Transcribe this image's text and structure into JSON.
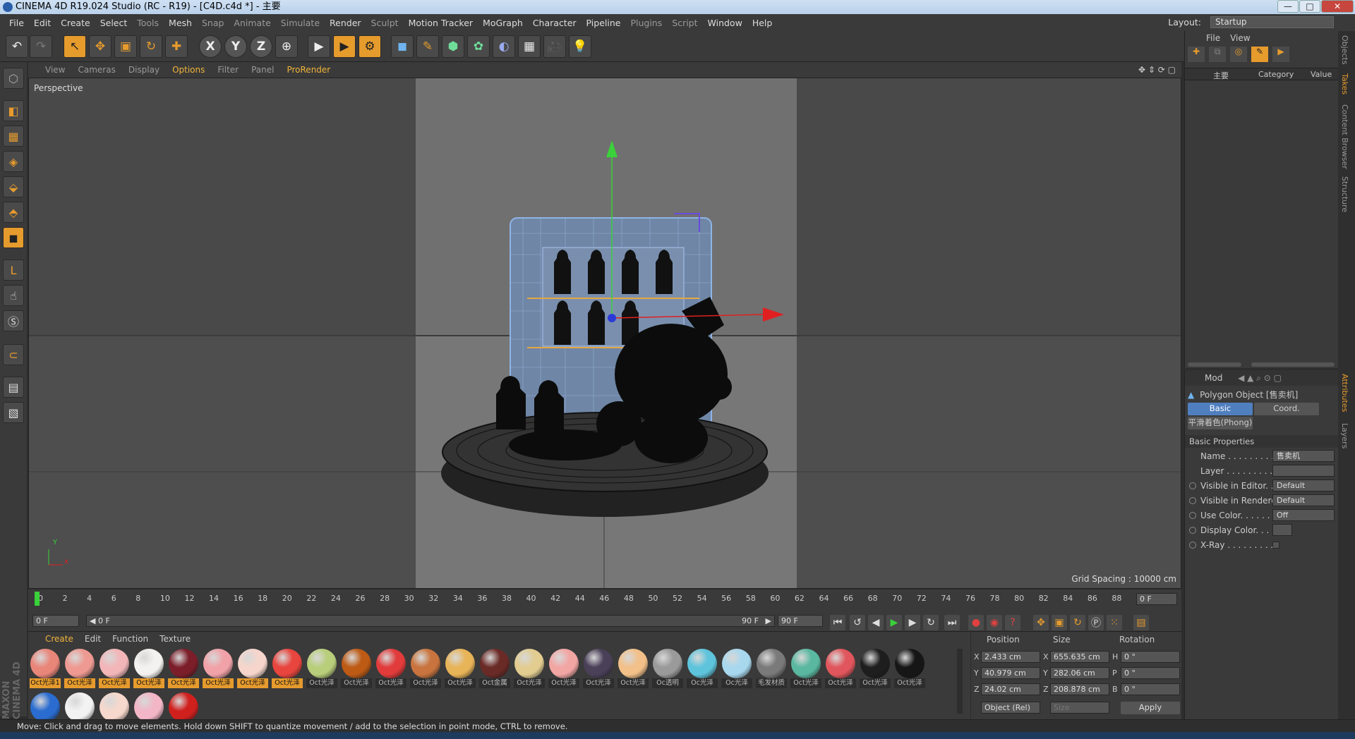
{
  "titlebar": {
    "title": "CINEMA 4D R19.024 Studio (RC - R19) - [C4D.c4d *] - 主要",
    "min": "—",
    "max": "□",
    "close": "✕"
  },
  "menubar": {
    "items": [
      "File",
      "Edit",
      "Create",
      "Select",
      "Tools",
      "Mesh",
      "Snap",
      "Animate",
      "Simulate",
      "Render",
      "Sculpt",
      "Motion Tracker",
      "MoGraph",
      "Character",
      "Pipeline",
      "Plugins",
      "Script",
      "Window",
      "Help"
    ],
    "layout_label": "Layout:",
    "layout_value": "Startup"
  },
  "toolbar": {
    "undo": "↶",
    "redo": "↷",
    "live_select": "↖",
    "move": "✥",
    "scale": "▣",
    "rotate": "↻",
    "last_tool": "✚",
    "x_axis": "X",
    "y_axis": "Y",
    "z_axis": "Z",
    "world": "⊕",
    "render_view": "▶",
    "render_pic": "▶",
    "render_settings": "⚙",
    "cube": "◼",
    "pen": "✎",
    "subdiv": "⬢",
    "array": "✿",
    "deform": "◐",
    "floor": "▦",
    "camera": "🎥",
    "light": "💡"
  },
  "viewport": {
    "menu": [
      "View",
      "Cameras",
      "Display",
      "Options",
      "Filter",
      "Panel",
      "ProRender"
    ],
    "label": "Perspective",
    "grid_spacing": "Grid Spacing : 10000 cm",
    "axis_x": "x",
    "axis_y": "Y"
  },
  "timeline": {
    "ticks": [
      0,
      2,
      4,
      6,
      8,
      10,
      12,
      14,
      16,
      18,
      20,
      22,
      24,
      26,
      28,
      30,
      32,
      34,
      36,
      38,
      40,
      42,
      44,
      46,
      48,
      50,
      52,
      54,
      56,
      58,
      60,
      62,
      64,
      66,
      68,
      70,
      72,
      74,
      76,
      78,
      80,
      82,
      84,
      86,
      88,
      90
    ],
    "current_frame": "0 F",
    "start": "0 F",
    "range_start": "0 F",
    "range_end": "90 F",
    "end": "90 F",
    "range_left": "◀",
    "range_right": "▶",
    "buttons": [
      "⏮",
      "↺",
      "◀",
      "▶",
      "▶",
      "↻",
      "⏭"
    ]
  },
  "materials": {
    "menu": [
      "Create",
      "Edit",
      "Function",
      "Texture"
    ],
    "items": [
      {
        "label": "Oct光泽1",
        "color": "#e9867a",
        "sel": true
      },
      {
        "label": "Oct光泽",
        "color": "#ee9a92",
        "sel": true
      },
      {
        "label": "Oct光泽",
        "color": "#f2b6b8",
        "sel": true
      },
      {
        "label": "Oct光泽",
        "color": "#f4f2f0",
        "sel": true
      },
      {
        "label": "Oct光泽",
        "color": "#7c1e2a",
        "sel": true
      },
      {
        "label": "Oct光泽",
        "color": "#f0a2a8",
        "sel": true
      },
      {
        "label": "Oct光泽",
        "color": "#f6d6cc",
        "sel": true
      },
      {
        "label": "Oct光泽",
        "color": "#e8453e",
        "sel": true
      },
      {
        "label": "Oct光泽",
        "color": "#b8ce7a",
        "sel": false
      },
      {
        "label": "Oct光泽",
        "color": "#bd5a14",
        "sel": false
      },
      {
        "label": "Oct光泽",
        "color": "#e13b3b",
        "sel": false
      },
      {
        "label": "Oct光泽",
        "color": "#c9743e",
        "sel": false
      },
      {
        "label": "Oct光泽",
        "color": "#e8b458",
        "sel": false
      },
      {
        "label": "Oct金属",
        "color": "#6a2a26",
        "sel": false
      },
      {
        "label": "Oct光泽",
        "color": "#e2cc90",
        "sel": false
      },
      {
        "label": "Oct光泽",
        "color": "#f2a6a4",
        "sel": false
      },
      {
        "label": "Oct光泽",
        "color": "#4a4058",
        "sel": false
      },
      {
        "label": "Oct光泽",
        "color": "#f2c088",
        "sel": false
      },
      {
        "label": "Oc透明",
        "color": "#9a9a9a",
        "sel": false
      },
      {
        "label": "Oc光泽",
        "color": "#5ec4dc",
        "sel": false
      },
      {
        "label": "Oc光泽",
        "color": "#a8d8ee",
        "sel": false
      },
      {
        "label": "毛发材质",
        "color": "#7a7a7a",
        "sel": false
      },
      {
        "label": "Oct光泽",
        "color": "#5ab8a0",
        "sel": false
      },
      {
        "label": "Oct光泽",
        "color": "#e0565c",
        "sel": false
      },
      {
        "label": "Oct光泽",
        "color": "#1e1e1e",
        "sel": false
      },
      {
        "label": "Oct光泽",
        "color": "#161616",
        "sel": false
      }
    ],
    "row2": [
      "#2a6cd0",
      "#f2f2f2",
      "#f6d8cc",
      "#f2b6c6",
      "#d0201e"
    ]
  },
  "coords": {
    "headers": [
      "Position",
      "Size",
      "Rotation"
    ],
    "rows": [
      {
        "axis": "X",
        "pos": "2.433 cm",
        "size_axis": "X",
        "size": "655.635 cm",
        "rot_axis": "H",
        "rot": "0 °"
      },
      {
        "axis": "Y",
        "pos": "40.979 cm",
        "size_axis": "Y",
        "size": "282.06 cm",
        "rot_axis": "P",
        "rot": "0 °"
      },
      {
        "axis": "Z",
        "pos": "24.02 cm",
        "size_axis": "Z",
        "size": "208.878 cm",
        "rot_axis": "B",
        "rot": "0 °"
      }
    ],
    "mode": "Object (Rel)",
    "size_mode": "Size",
    "apply": "Apply"
  },
  "object_manager": {
    "menu": [
      "File",
      "View"
    ],
    "columns": [
      "主要",
      "Category",
      "Value"
    ]
  },
  "attributes": {
    "menu": "Mod",
    "object": "Polygon Object [售卖机]",
    "tabs": [
      "Basic",
      "Coord."
    ],
    "phong": "平滑着色(Phong)",
    "section": "Basic Properties",
    "rows": [
      {
        "key": "Name . . . . . . . . . . .",
        "val": "售卖机",
        "radio": false
      },
      {
        "key": "Layer . . . . . . . . . . .",
        "val": "",
        "radio": false
      },
      {
        "key": "Visible in Editor. . .",
        "val": "Default",
        "radio": true
      },
      {
        "key": "Visible in Renderer",
        "val": "Default",
        "radio": true
      },
      {
        "key": "Use Color. . . . . . . .",
        "val": "Off",
        "radio": true
      },
      {
        "key": "Display Color. . .",
        "val": "",
        "radio": true
      },
      {
        "key": "X-Ray . . . . . . . . . .",
        "val": "",
        "radio": true
      }
    ]
  },
  "side_tabs": [
    "Objects",
    "Takes",
    "Content Browser",
    "Structure",
    "Attributes",
    "Layers"
  ],
  "status": "Move: Click and drag to move elements. Hold down SHIFT to quantize movement / add to the selection in point mode, CTRL to remove.",
  "brand": "MAXON CINEMA 4D"
}
